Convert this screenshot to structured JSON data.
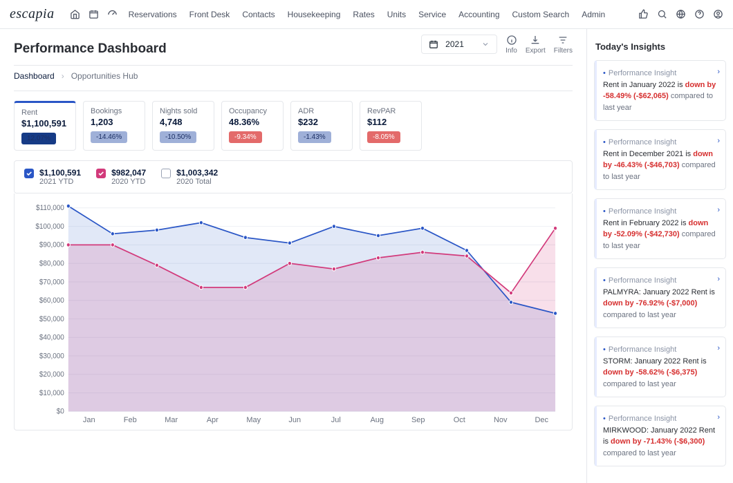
{
  "nav": {
    "logo": "escapia",
    "links": [
      "Reservations",
      "Front Desk",
      "Contacts",
      "Housekeeping",
      "Rates",
      "Units",
      "Service",
      "Accounting",
      "Custom Search",
      "Admin"
    ]
  },
  "header": {
    "title": "Performance Dashboard",
    "breadcrumbs": [
      "Dashboard",
      "Opportunities Hub"
    ],
    "year": "2021",
    "tools": {
      "info": "Info",
      "export": "Export",
      "filters": "Filters"
    }
  },
  "kpis": [
    {
      "label": "Rent",
      "value": "$1,100,591",
      "delta": "12.07%",
      "deltaClass": "blue",
      "active": true
    },
    {
      "label": "Bookings",
      "value": "1,203",
      "delta": "-14.46%",
      "deltaClass": "blue"
    },
    {
      "label": "Nights sold",
      "value": "4,748",
      "delta": "-10.50%",
      "deltaClass": "blue"
    },
    {
      "label": "Occupancy",
      "value": "48.36%",
      "delta": "-9.34%",
      "deltaClass": "red"
    },
    {
      "label": "ADR",
      "value": "$232",
      "delta": "-1.43%",
      "deltaClass": "blue"
    },
    {
      "label": "RevPAR",
      "value": "$112",
      "delta": "-8.05%",
      "deltaClass": "red"
    }
  ],
  "legend": [
    {
      "value": "$1,100,591",
      "sub": "2021 YTD",
      "checked": true,
      "color": "blue"
    },
    {
      "value": "$982,047",
      "sub": "2020 YTD",
      "checked": true,
      "color": "pink"
    },
    {
      "value": "$1,003,342",
      "sub": "2020 Total",
      "checked": false,
      "color": "none"
    }
  ],
  "chart_data": {
    "type": "line",
    "title": "",
    "xlabel": "",
    "ylabel": "",
    "ylim": [
      0,
      110000
    ],
    "categories": [
      "Jan",
      "Feb",
      "Mar",
      "Apr",
      "May",
      "Jun",
      "Jul",
      "Aug",
      "Sep",
      "Oct",
      "Nov",
      "Dec"
    ],
    "series": [
      {
        "name": "2021 YTD",
        "color": "#2a56c6",
        "values": [
          111000,
          96000,
          98000,
          102000,
          94000,
          91000,
          100000,
          95000,
          99000,
          87000,
          59000,
          53000
        ]
      },
      {
        "name": "2020 YTD",
        "color": "#d23a7b",
        "values": [
          90000,
          90000,
          79000,
          67000,
          67000,
          80000,
          77000,
          83000,
          86000,
          84000,
          64000,
          99000
        ]
      }
    ],
    "yticks": [
      0,
      10000,
      20000,
      30000,
      40000,
      50000,
      60000,
      70000,
      80000,
      90000,
      100000,
      110000
    ],
    "ytick_labels": [
      "$0",
      "$10,000",
      "$20,000",
      "$30,000",
      "$40,000",
      "$50,000",
      "$60,000",
      "$70,000",
      "$80,000",
      "$90,000",
      "$100,000",
      "$110,000"
    ]
  },
  "insights": {
    "title": "Today's Insights",
    "tag": "Performance Insight",
    "compared": "compared to last year",
    "items": [
      {
        "pre": "Rent in January 2022 is ",
        "down": "down by -58.49% (-$62,065) "
      },
      {
        "pre": "Rent in December 2021 is ",
        "down": "down by -46.43% (-$46,703) "
      },
      {
        "pre": "Rent in February 2022 is ",
        "down": "down by -52.09% (-$42,730) "
      },
      {
        "pre": "PALMYRA: January 2022 Rent is ",
        "down": "down by -76.92% (-$7,000) "
      },
      {
        "pre": "STORM: January 2022 Rent is ",
        "down": "down by -58.62% (-$6,375) "
      },
      {
        "pre": "MIRKWOOD: January 2022 Rent is ",
        "down": "down by -71.43% (-$6,300) "
      }
    ]
  }
}
